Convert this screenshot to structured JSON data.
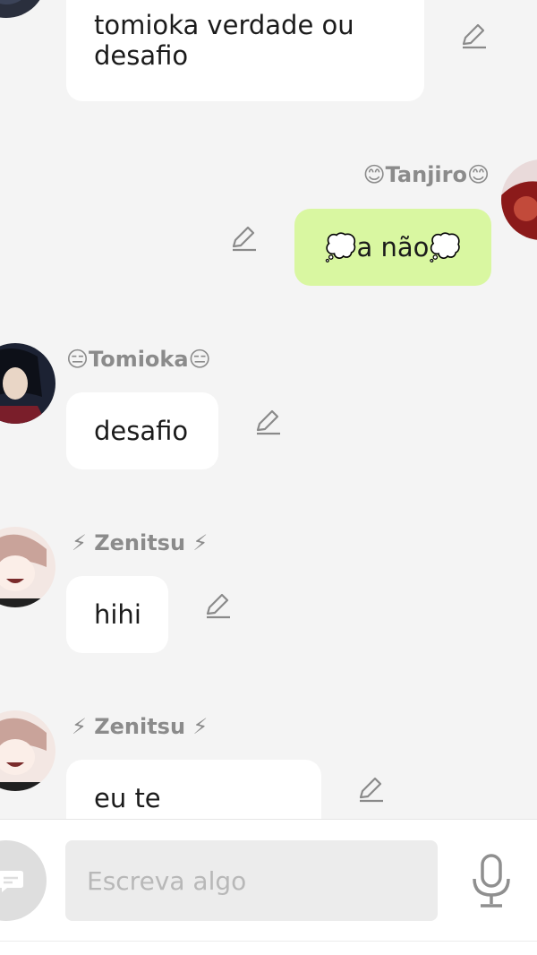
{
  "messages": [
    {
      "sender": "",
      "text": "tomioka verdade ou desafio"
    },
    {
      "sender": "😊Tanjiro😊",
      "text": "💭a não💭"
    },
    {
      "sender": "😑Tomioka😑",
      "text": "desafio"
    },
    {
      "sender": "⚡ Zenitsu ⚡",
      "text": "hihi"
    },
    {
      "sender": "⚡ Zenitsu ⚡",
      "text": "eu te desafio...."
    }
  ],
  "input": {
    "placeholder": "Escreva algo"
  },
  "icons": {
    "edit": "pencil-icon",
    "menu": "chat-menu-icon",
    "mic": "microphone-icon"
  },
  "colors": {
    "background": "#f4f4f4",
    "bubble_other": "#ffffff",
    "bubble_mine": "#d9f7a1",
    "sender_name": "#8b8b8b"
  }
}
